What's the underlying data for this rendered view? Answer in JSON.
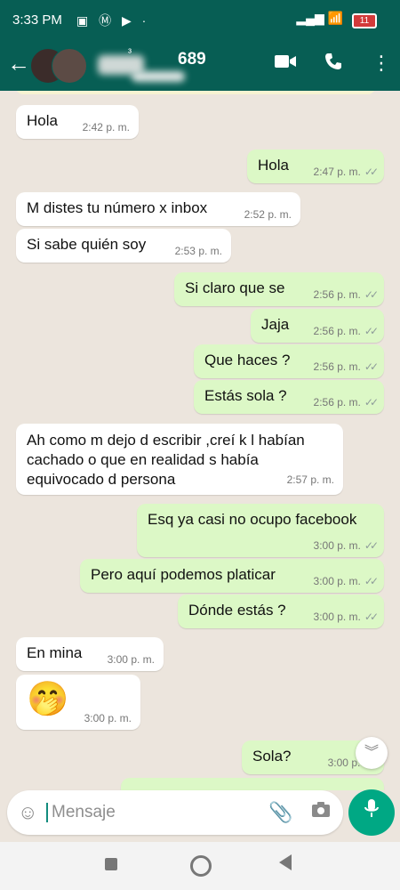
{
  "status_bar": {
    "time": "3:33 PM",
    "icons": "▣ Ⓜ ▶ ·",
    "battery": "11"
  },
  "header": {
    "contact_prefix": "³",
    "contact_suffix": "689"
  },
  "messages": [
    {
      "dir": "in",
      "text": "Hola",
      "time": "2:42 p. m."
    },
    {
      "dir": "out",
      "text": "Hola",
      "time": "2:47 p. m."
    },
    {
      "dir": "in",
      "text": "M distes tu número x inbox",
      "time": "2:52 p. m."
    },
    {
      "dir": "in",
      "text": "Si sabe quién soy",
      "time": "2:53 p. m."
    },
    {
      "dir": "out",
      "text": "Si claro que se",
      "time": "2:56 p. m."
    },
    {
      "dir": "out",
      "text": "Jaja",
      "time": "2:56 p. m."
    },
    {
      "dir": "out",
      "text": "Que haces ?",
      "time": "2:56 p. m."
    },
    {
      "dir": "out",
      "text": "Estás sola ?",
      "time": "2:56 p. m."
    },
    {
      "dir": "in",
      "text": "Ah como m dejo d escribir ,creí k l habían cachado o que en realidad s había equivocado d persona",
      "time": "2:57 p. m."
    },
    {
      "dir": "out",
      "text": "Esq ya casi no ocupo facebook",
      "time": "3:00 p. m."
    },
    {
      "dir": "out",
      "text": "Pero aquí podemos platicar",
      "time": "3:00 p. m."
    },
    {
      "dir": "out",
      "text": "Dónde estás ?",
      "time": "3:00 p. m."
    },
    {
      "dir": "in",
      "text": "En mina",
      "time": "3:00 p. m."
    },
    {
      "dir": "in",
      "text": "🤭",
      "time": "3:00 p. m."
    },
    {
      "dir": "out",
      "text": "Sola?",
      "time": "3:00 p. m."
    }
  ],
  "composer": {
    "placeholder": "Mensaje"
  },
  "colors": {
    "header": "#075e54",
    "outgoing": "#dcf8c6",
    "incoming": "#ffffff",
    "accent": "#00a884"
  },
  "icons": {
    "back": "arrow-left-icon",
    "video": "video-call-icon",
    "call": "phone-icon",
    "menu": "more-vert-icon",
    "emoji": "emoji-icon",
    "attach": "paperclip-icon",
    "camera": "camera-icon",
    "mic": "mic-icon",
    "scroll": "chevron-double-down-icon"
  }
}
